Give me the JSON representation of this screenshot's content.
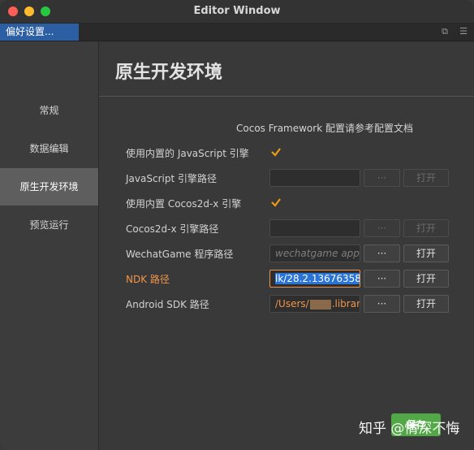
{
  "window": {
    "title": "Editor Window"
  },
  "tab": {
    "label": "偏好设置...",
    "icons": [
      "restore-icon",
      "menu-icon"
    ]
  },
  "sidebar": {
    "items": [
      {
        "label": "常规",
        "active": false
      },
      {
        "label": "数据编辑",
        "active": false
      },
      {
        "label": "原生开发环境",
        "active": true
      },
      {
        "label": "预览运行",
        "active": false
      }
    ]
  },
  "main": {
    "heading": "原生开发环境",
    "doc_link": "Cocos Framework 配置请参考配置文档",
    "rows": [
      {
        "label": "使用内置的 JavaScript 引擎",
        "type": "checkbox",
        "checked": true
      },
      {
        "label": "JavaScript 引擎路径",
        "type": "path",
        "value": "",
        "dots": "···",
        "open": "打开",
        "enabled": false
      },
      {
        "label": "使用内置 Cocos2d-x 引擎",
        "type": "checkbox",
        "checked": true
      },
      {
        "label": "Cocos2d-x 引擎路径",
        "type": "path",
        "value": "",
        "dots": "···",
        "open": "打开",
        "enabled": false
      },
      {
        "label": "WechatGame 程序路径",
        "type": "path",
        "placeholder": "wechatgame app",
        "dots": "···",
        "open": "打开",
        "enabled": true
      },
      {
        "label": "NDK 路径",
        "type": "path",
        "value": "lk/28.2.13676358",
        "dots": "···",
        "open": "打开",
        "enabled": true,
        "highlight": true
      },
      {
        "label": "Android SDK 路径",
        "type": "path",
        "value_pre": "/Users/",
        "value_post": ".library",
        "dots": "···",
        "open": "打开",
        "enabled": true
      }
    ]
  },
  "save_button": {
    "label": "保存"
  },
  "watermark": {
    "text": "知乎 @情深不悔"
  },
  "colors": {
    "accent_blue": "#2c5ea3",
    "warning_orange": "#f0954a",
    "check_orange": "#f39c12",
    "save_green": "#52a846"
  }
}
